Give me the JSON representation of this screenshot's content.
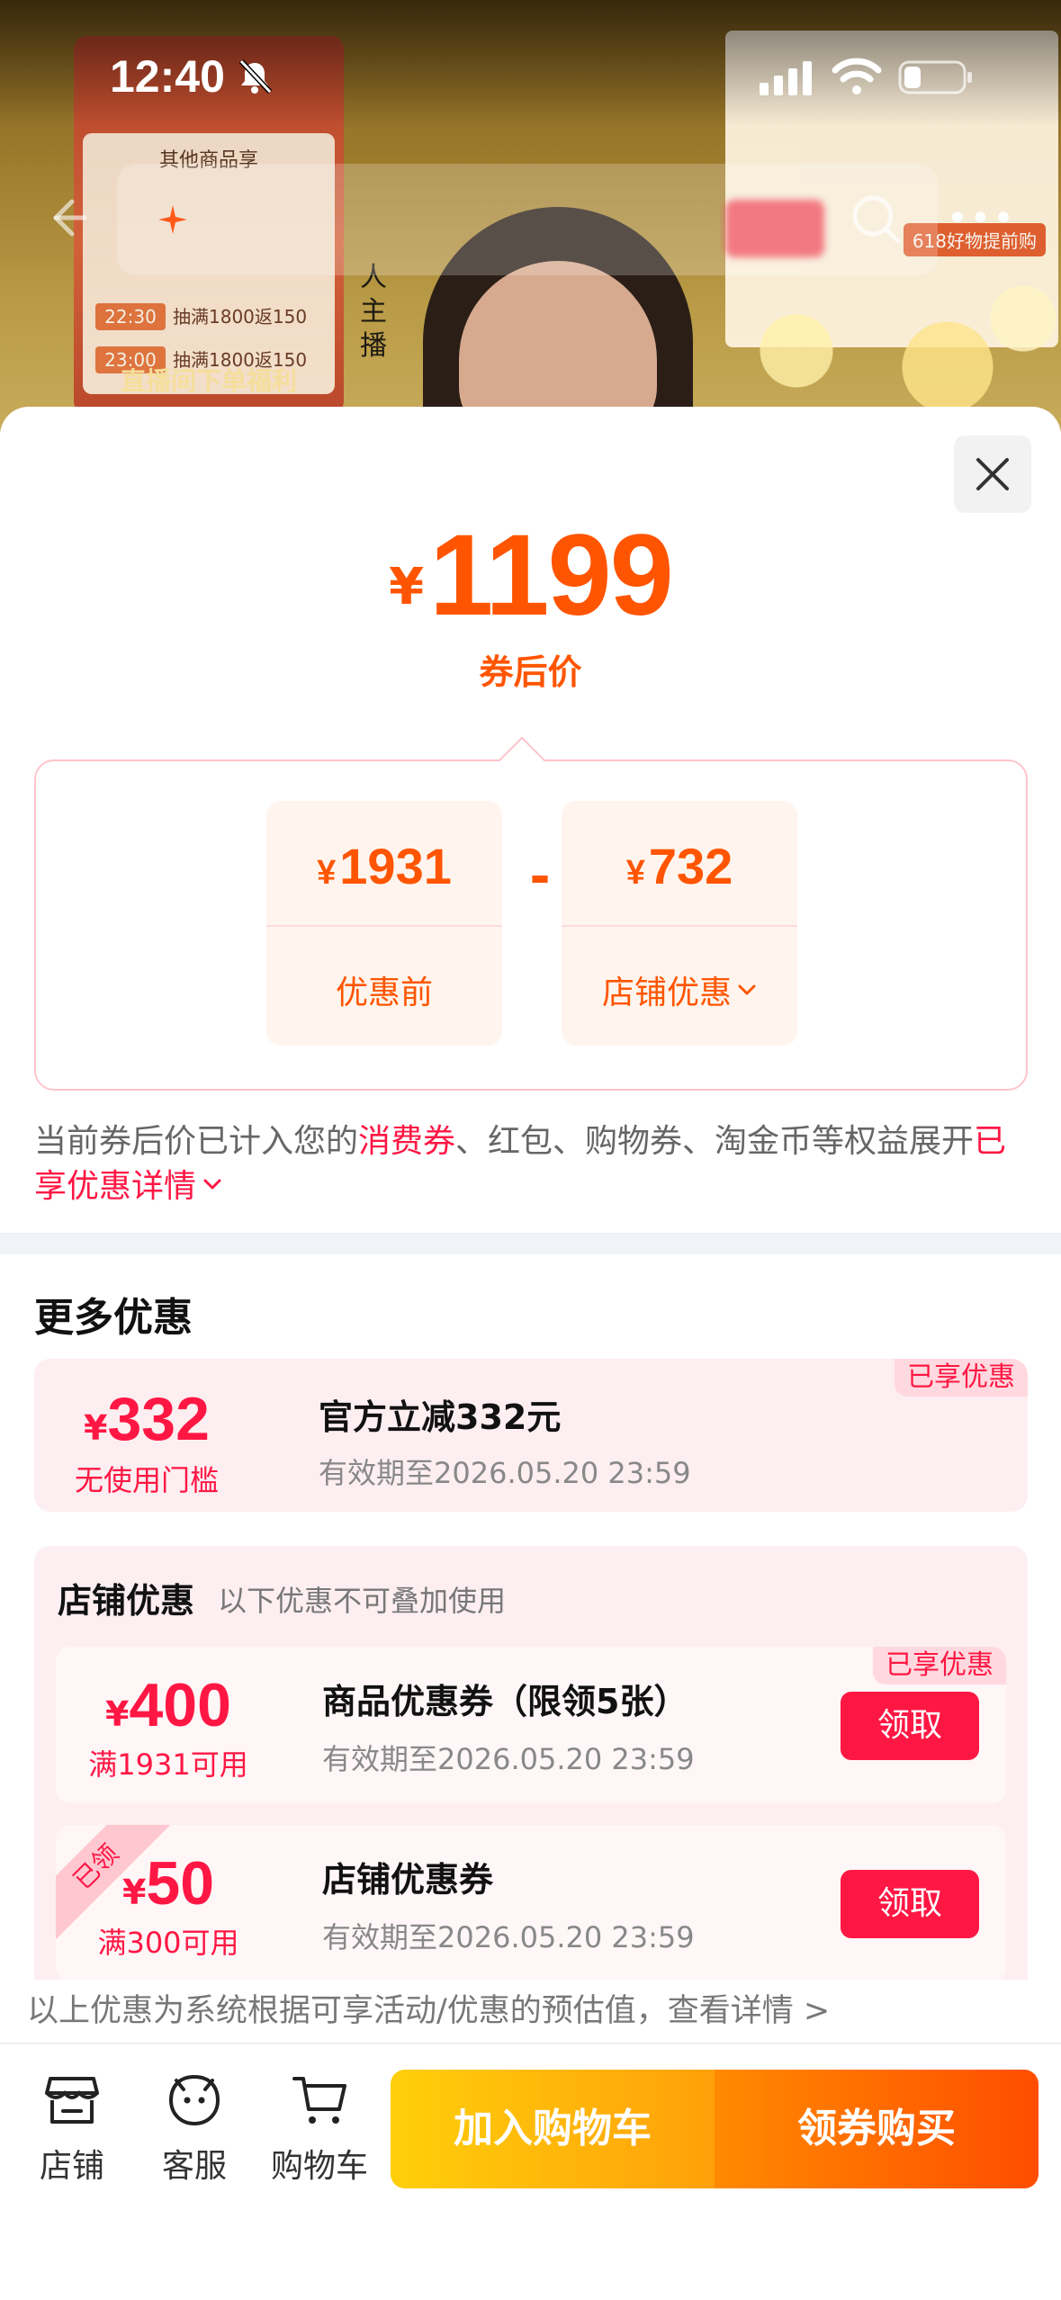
{
  "status_bar": {
    "time": "12:40"
  },
  "background": {
    "poster_left": {
      "title": "其他商品享",
      "rows": [
        {
          "time": "22:30",
          "desc": "抽满1800返150"
        },
        {
          "time": "23:00",
          "desc": "抽满1800返150"
        }
      ],
      "footer": "直播间下单福利"
    },
    "side_text": "人主播",
    "poster_right_badge": "618好物提前购"
  },
  "sheet": {
    "price_symbol": "¥",
    "price": "1199",
    "price_label": "券后价",
    "calc": {
      "before": {
        "symbol": "¥",
        "value": "1931",
        "label": "优惠前"
      },
      "operator": "-",
      "discount": {
        "symbol": "¥",
        "value": "732",
        "label": "店铺优惠"
      }
    },
    "note": {
      "part1": "当前券后价已计入您的",
      "highlight1": "消费券",
      "part2": "、红包、购物券、淘金币等权益展开",
      "highlight2": "已享优惠详情"
    },
    "more_title": "更多优惠",
    "official": {
      "symbol": "¥",
      "amount": "332",
      "condition": "无使用门槛",
      "title": "官方立减332元",
      "valid": "有效期至2026.05.20 23:59",
      "tag": "已享优惠"
    },
    "shop": {
      "heading": "店铺优惠",
      "subheading": "以下优惠不可叠加使用",
      "coupons": [
        {
          "symbol": "¥",
          "amount": "400",
          "condition": "满1931可用",
          "title": "商品优惠券（限领5张）",
          "valid": "有效期至2026.05.20 23:59",
          "tag": "已享优惠",
          "button": "领取"
        },
        {
          "symbol": "¥",
          "amount": "50",
          "condition": "满300可用",
          "title": "店铺优惠券",
          "valid": "有效期至2026.05.20 23:59",
          "corner": "已领",
          "button": "领取"
        }
      ]
    },
    "footer_note": "以上优惠为系统根据可享活动/优惠的预估值，查看详情 >"
  },
  "bottom_bar": {
    "shop_label": "店铺",
    "service_label": "客服",
    "cart_label": "购物车",
    "add_to_cart": "加入购物车",
    "buy_with_coupon": "领券购买"
  },
  "colors": {
    "price_orange": "#ff5500",
    "accent_red": "#ff1744",
    "coupon_bg": "#fdeef1"
  }
}
